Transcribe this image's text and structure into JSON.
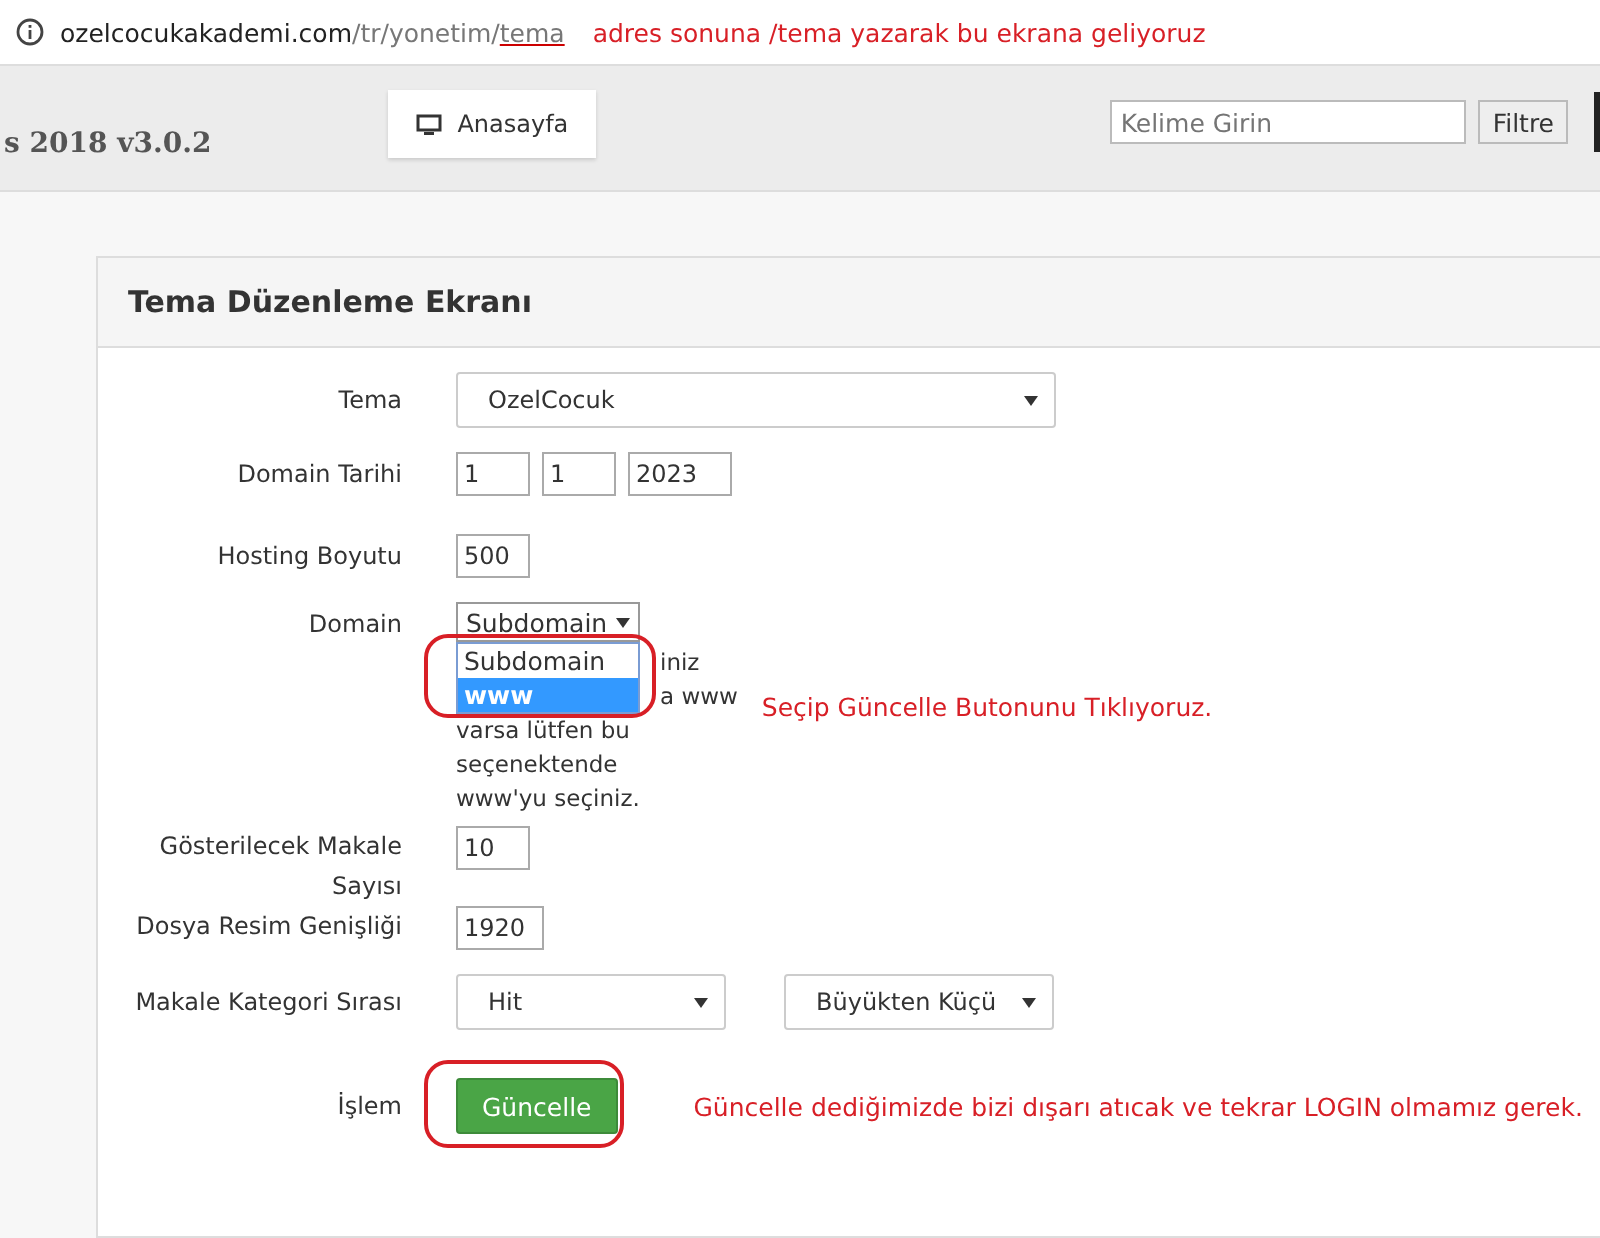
{
  "address_bar": {
    "host": "ozelcocukakademi.com",
    "path": "/tr/yonetim/",
    "tail": "tema",
    "note": "adres sonuna /tema yazarak bu ekrana geliyoruz"
  },
  "header": {
    "brand": "s 2018 v3.0.2",
    "home_tab": "Anasayfa",
    "search": {
      "placeholder": "Kelime Girin"
    },
    "filter_button": "Filtre"
  },
  "panel": {
    "title": "Tema Düzenleme Ekranı",
    "rows": [
      {
        "kind": "select",
        "label": "Tema",
        "value": "OzelCocuk"
      },
      {
        "kind": "date",
        "label": "Domain Tarihi",
        "values": [
          "1",
          "1",
          "2023"
        ]
      },
      {
        "kind": "text",
        "label": "Hosting Boyutu",
        "value": "500"
      },
      {
        "kind": "domain",
        "label": "Domain",
        "value": "Subdomain",
        "options": [
          {
            "label": "Subdomain",
            "highlighted": false
          },
          {
            "label": "www",
            "highlighted": true
          }
        ],
        "hint_lines": [
          "iniz",
          "a www",
          "varsa lütfen bu",
          "seçenektende",
          "www'yu seçiniz."
        ],
        "note": "Seçip Güncelle Butonunu Tıklıyoruz."
      },
      {
        "kind": "text",
        "label": "Gösterilecek Makale Sayısı",
        "value": "10"
      },
      {
        "kind": "text",
        "label": "Dosya Resim Genişliği",
        "value": "1920"
      },
      {
        "kind": "select_pair",
        "label": "Makale Kategori Sırası",
        "values": [
          "Hit",
          "Büyükten Küçü"
        ]
      },
      {
        "kind": "button",
        "label": "İşlem",
        "value": "Güncelle",
        "note": "Güncelle dediğimizde bizi dışarı atıcak ve tekrar LOGIN olmamız gerek."
      }
    ]
  }
}
